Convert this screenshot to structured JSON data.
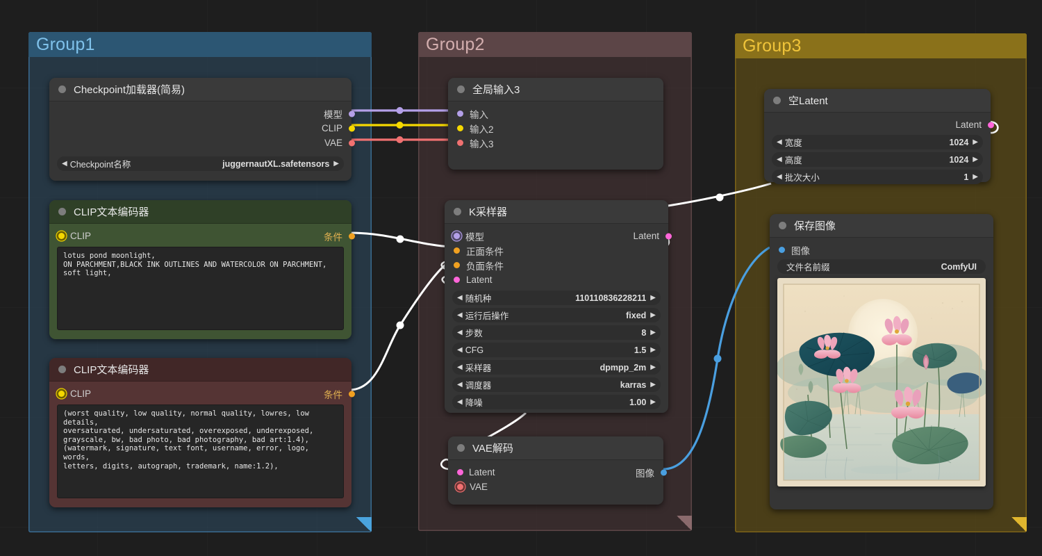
{
  "canvas": {
    "background": "#1e1e1e",
    "grid": true
  },
  "groups": [
    {
      "title": "Group1",
      "accent": "#4a90c8"
    },
    {
      "title": "Group2",
      "accent": "#7d6163"
    },
    {
      "title": "Group3",
      "accent": "#c79a1e"
    }
  ],
  "nodes": {
    "checkpoint_loader": {
      "title": "Checkpoint加载器(简易)",
      "outputs": [
        {
          "label": "模型",
          "color": "#b4a0e8"
        },
        {
          "label": "CLIP",
          "color": "#f5d800"
        },
        {
          "label": "VAE",
          "color": "#f07171"
        }
      ],
      "widgets": [
        {
          "name": "Checkpoint名称",
          "value": "juggernautXL.safetensors"
        }
      ]
    },
    "clip_positive": {
      "title": "CLIP文本编码器",
      "input": {
        "label": "CLIP",
        "color": "#f5d800"
      },
      "output": {
        "label": "条件",
        "color": "#f0a020"
      },
      "text": "lotus pond moonlight,\nON PARCHMENT,BLACK INK OUTLINES AND WATERCOLOR ON PARCHMENT,\nsoft light,"
    },
    "clip_negative": {
      "title": "CLIP文本编码器",
      "input": {
        "label": "CLIP",
        "color": "#f5d800"
      },
      "output": {
        "label": "条件",
        "color": "#f0a020"
      },
      "text": "(worst quality, low quality, normal quality, lowres, low details,\noversaturated, undersaturated, overexposed, underexposed,\ngrayscale, bw, bad photo, bad photography, bad art:1.4),\n(watermark, signature, text font, username, error, logo, words,\nletters, digits, autograph, trademark, name:1.2),"
    },
    "global_input": {
      "title": "全局输入3",
      "inputs": [
        {
          "label": "输入",
          "color": "#b4a0e8"
        },
        {
          "label": "输入2",
          "color": "#f5d800"
        },
        {
          "label": "输入3",
          "color": "#f07171"
        }
      ]
    },
    "ksampler": {
      "title": "K采样器",
      "inputs": [
        {
          "label": "模型",
          "color": "#b4a0e8"
        },
        {
          "label": "正面条件",
          "color": "#f0a020"
        },
        {
          "label": "负面条件",
          "color": "#f0a020"
        },
        {
          "label": "Latent",
          "color": "#ff66d9"
        }
      ],
      "outputs": [
        {
          "label": "Latent",
          "color": "#ff66d9"
        }
      ],
      "widgets": [
        {
          "name": "随机种",
          "value": "110110836228211"
        },
        {
          "name": "运行后操作",
          "value": "fixed"
        },
        {
          "name": "步数",
          "value": "8"
        },
        {
          "name": "CFG",
          "value": "1.5"
        },
        {
          "name": "采样器",
          "value": "dpmpp_2m"
        },
        {
          "name": "调度器",
          "value": "karras"
        },
        {
          "name": "降噪",
          "value": "1.00"
        }
      ]
    },
    "vae_decode": {
      "title": "VAE解码",
      "inputs": [
        {
          "label": "Latent",
          "color": "#ff66d9"
        },
        {
          "label": "VAE",
          "color": "#f07171"
        }
      ],
      "outputs": [
        {
          "label": "图像",
          "color": "#4a9fe0"
        }
      ]
    },
    "empty_latent": {
      "title": "空Latent",
      "outputs": [
        {
          "label": "Latent",
          "color": "#ff66d9"
        }
      ],
      "widgets": [
        {
          "name": "宽度",
          "value": "1024"
        },
        {
          "name": "高度",
          "value": "1024"
        },
        {
          "name": "批次大小",
          "value": "1"
        }
      ]
    },
    "save_image": {
      "title": "保存图像",
      "inputs": [
        {
          "label": "图像",
          "color": "#4a9fe0"
        }
      ],
      "widgets": [
        {
          "name": "文件名前缀",
          "value": "ComfyUI"
        }
      ],
      "preview_alt": "lotus pond moonlight watercolor on parchment"
    }
  },
  "icons": {
    "arrow_left": "◀",
    "arrow_right": "▶"
  }
}
